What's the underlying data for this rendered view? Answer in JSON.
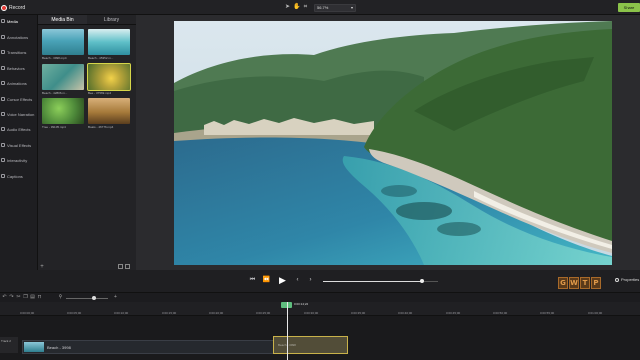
{
  "app": {
    "record_label": "Record",
    "zoom_value": "56.7%",
    "share_label": "Share"
  },
  "sidebar": {
    "items": [
      {
        "label": "Media"
      },
      {
        "label": "Annotations"
      },
      {
        "label": "Transitions"
      },
      {
        "label": "Behaviors"
      },
      {
        "label": "Animations"
      },
      {
        "label": "Cursor Effects"
      },
      {
        "label": "Voice Narration"
      },
      {
        "label": "Audio Effects"
      },
      {
        "label": "Visual Effects"
      },
      {
        "label": "Interactivity"
      },
      {
        "label": "Captions"
      }
    ]
  },
  "media_bin": {
    "tabs": [
      {
        "label": "Media Bin"
      },
      {
        "label": "Library"
      }
    ],
    "items": [
      {
        "caption": "Beach - 3998.mp4",
        "color": "#4aa3b8"
      },
      {
        "caption": "Beach - 45352.m...",
        "color": "#5fc0c8"
      },
      {
        "caption": "Beach - 42806.m...",
        "color": "#3f8e8a"
      },
      {
        "caption": "Bee - 37569.mp4",
        "color": "#b8a43a"
      },
      {
        "caption": "Tree - 39105.mp4",
        "color": "#4e8a3a"
      },
      {
        "caption": "Boats - 46776.mp4",
        "color": "#a67a3a"
      }
    ]
  },
  "playback": {
    "progress": 0.86
  },
  "watermark": [
    "G",
    "W",
    "T",
    "P"
  ],
  "properties_label": "Properties",
  "timeline": {
    "playhead_time": "0:00:14;22",
    "ticks": [
      "0:00:00;00",
      "0:00:05;00",
      "0:00:10;00",
      "0:00:15;00",
      "0:00:20;00",
      "0:00:25;00",
      "0:00:30;00",
      "0:00:35;00",
      "0:00:40;00",
      "0:00:45;00",
      "0:00:50;00",
      "0:00:55;00",
      "0:01:00;00"
    ],
    "track_label": "Track 2",
    "clip_label": "Beach - 3998",
    "ghost_label": "Beach - 3998"
  }
}
